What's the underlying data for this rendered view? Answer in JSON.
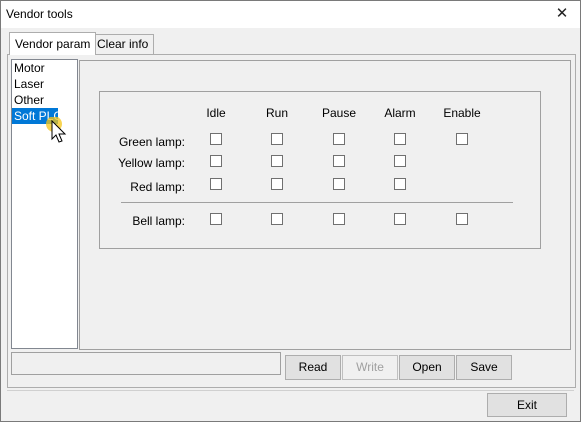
{
  "window": {
    "title": "Vendor tools",
    "close_glyph": "✕"
  },
  "tabs": [
    {
      "label": "Vendor param",
      "active": true
    },
    {
      "label": "Clear info",
      "active": false
    }
  ],
  "sidebar": {
    "items": [
      {
        "label": "Motor"
      },
      {
        "label": "Laser"
      },
      {
        "label": "Other"
      },
      {
        "label": "Soft PLC",
        "selected": true
      }
    ]
  },
  "lamps": {
    "columns": [
      "Idle",
      "Run",
      "Pause",
      "Alarm",
      "Enable"
    ],
    "rows": [
      {
        "label": "Green lamp:",
        "checked": [
          false,
          false,
          false,
          false,
          false
        ]
      },
      {
        "label": "Yellow lamp:",
        "checked": [
          false,
          false,
          false,
          false
        ]
      },
      {
        "label": "Red lamp:",
        "checked": [
          false,
          false,
          false,
          false
        ]
      },
      {
        "label": "Bell lamp:",
        "checked": [
          false,
          false,
          false,
          false,
          false
        ]
      }
    ]
  },
  "status_text": "",
  "buttons": {
    "read": "Read",
    "write": "Write",
    "open": "Open",
    "save": "Save",
    "exit": "Exit"
  },
  "colors": {
    "selection": "#0078d7",
    "window_bg": "#f0f0f0"
  }
}
